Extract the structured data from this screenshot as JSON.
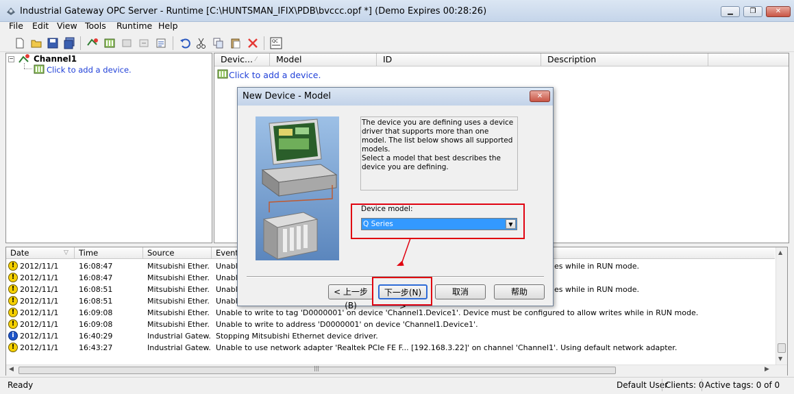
{
  "window": {
    "title": "Industrial Gateway OPC Server - Runtime [C:\\HUNTSMAN_IFIX\\PDB\\bvccc.opf *] (Demo Expires 00:28:26)",
    "minimize": "▁",
    "restore": "❐",
    "close": "✕"
  },
  "menu": [
    "File",
    "Edit",
    "View",
    "Tools",
    "Runtime",
    "Help"
  ],
  "tree": {
    "channel": "Channel1",
    "add_device": "Click to add a device."
  },
  "device_list": {
    "columns": [
      "Devic...",
      "Model",
      "ID",
      "Description"
    ],
    "add_device": "Click to add a device."
  },
  "log": {
    "columns": [
      "Date",
      "Time",
      "Source",
      "Event"
    ],
    "rows": [
      {
        "type": "warning",
        "date": "2012/11/1",
        "time": "16:08:47",
        "source": "Mitsubishi Ether...",
        "event": "Unable",
        "tail": "es while in RUN mode."
      },
      {
        "type": "warning",
        "date": "2012/11/1",
        "time": "16:08:47",
        "source": "Mitsubishi Ether...",
        "event": "Unable",
        "tail": ""
      },
      {
        "type": "warning",
        "date": "2012/11/1",
        "time": "16:08:51",
        "source": "Mitsubishi Ether...",
        "event": "Unable",
        "tail": "es while in RUN mode."
      },
      {
        "type": "warning",
        "date": "2012/11/1",
        "time": "16:08:51",
        "source": "Mitsubishi Ether...",
        "event": "Unable",
        "tail": ""
      },
      {
        "type": "warning",
        "date": "2012/11/1",
        "time": "16:09:08",
        "source": "Mitsubishi Ether...",
        "event": "Unable to write to tag 'D0000001' on device 'Channel1.Device1'. Device must be configured to allow writes while in RUN mode.",
        "tail": ""
      },
      {
        "type": "warning",
        "date": "2012/11/1",
        "time": "16:09:08",
        "source": "Mitsubishi Ether...",
        "event": "Unable to write to address 'D0000001' on device 'Channel1.Device1'.",
        "tail": ""
      },
      {
        "type": "info",
        "date": "2012/11/1",
        "time": "16:40:29",
        "source": "Industrial Gatew...",
        "event": "Stopping Mitsubishi Ethernet device driver.",
        "tail": ""
      },
      {
        "type": "warning",
        "date": "2012/11/1",
        "time": "16:43:27",
        "source": "Industrial Gatew...",
        "event": "Unable to use network adapter 'Realtek PCIe FE F... [192.168.3.22]' on channel 'Channel1'.  Using default network adapter.",
        "tail": ""
      }
    ]
  },
  "dialog": {
    "title": "New Device - Model",
    "description_line1": "The device you are defining uses a device driver that supports more than one model.  The list below shows all supported models.",
    "description_line2": "Select  a model that best describes the device you are defining.",
    "model_label": "Device model:",
    "model_value": "Q Series",
    "buttons": {
      "back": "< 上一步(B)",
      "next": "下一步(N) >",
      "cancel": "取消",
      "help": "帮助"
    }
  },
  "status": {
    "ready": "Ready",
    "user": "Default User",
    "clients": "Clients:  0",
    "active_tags": "Active tags:  0 of 0"
  },
  "colors": {
    "highlight": "#3399ff",
    "annotation": "#e0000f"
  }
}
